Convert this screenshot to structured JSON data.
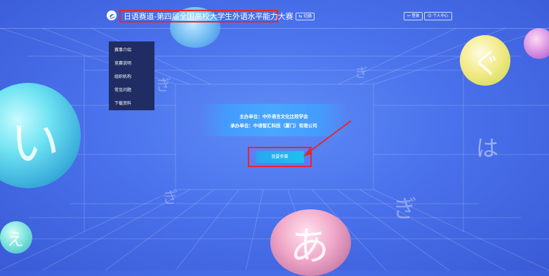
{
  "header": {
    "title": "日语赛道-第四届全国高校大学生外语水平能力大赛",
    "switch_label": "⇆ 切换",
    "register_label": "登录",
    "personal_center_label": "个人中心"
  },
  "sidebar": {
    "items": [
      {
        "label": "赛事介绍"
      },
      {
        "label": "竞赛说明"
      },
      {
        "label": "组织机构"
      },
      {
        "label": "常见问题"
      },
      {
        "label": "下载资料"
      }
    ]
  },
  "main": {
    "sponsor": "主办单位：中外语言文化比较学会",
    "organizer": "承办单位：中语智汇科技（厦门）有限公司"
  },
  "signup": {
    "label": "我要参赛"
  },
  "decor": {
    "kana": [
      "い",
      "ぎ",
      "ぐ",
      "は",
      "ぎ",
      "ぎ",
      "あ",
      "え"
    ]
  },
  "colors": {
    "background": "#4a72ec",
    "menu_bg": "#1f2d64",
    "highlight_border": "#e2282e",
    "button": "#1ec0ee"
  }
}
